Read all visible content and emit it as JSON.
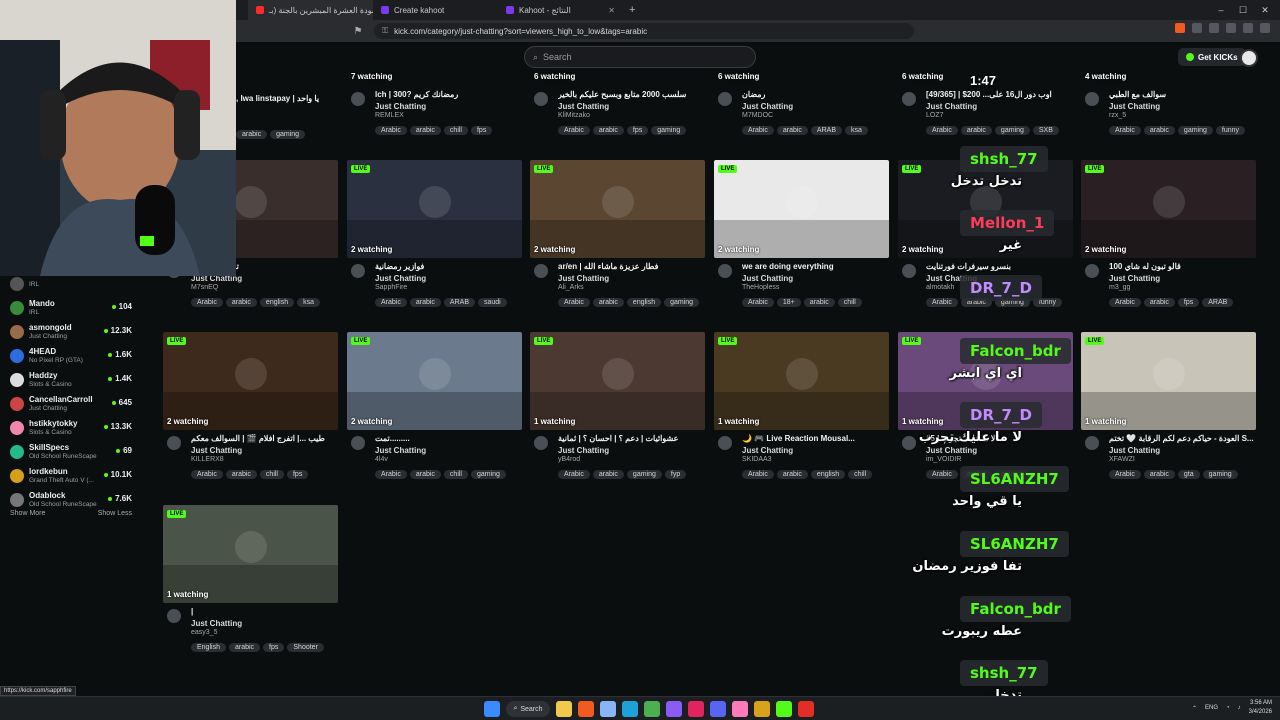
{
  "browser": {
    "tabs": [
      {
        "title": "أنشودة العشرة المبشرين بالجنة (بـ...",
        "active": true
      },
      {
        "title": "Create kahoot",
        "active": false
      },
      {
        "title": "Kahoot - النتائج",
        "active": false
      }
    ],
    "url": "kick.com/category/just-chatting?sort=viewers_high_to_low&tags=arabic"
  },
  "header": {
    "search_placeholder": "Search",
    "get_kicks": "Get KICKs"
  },
  "sidebar": {
    "items": [
      {
        "name": "",
        "category": "IRL",
        "viewers": ""
      },
      {
        "name": "Mando",
        "category": "IRL",
        "viewers": "104"
      },
      {
        "name": "asmongold",
        "category": "Just Chatting",
        "viewers": "12.3K"
      },
      {
        "name": "4HEAD",
        "category": "No Pixel RP (GTA)",
        "viewers": "1.6K"
      },
      {
        "name": "Haddzy",
        "category": "Slots & Casino",
        "viewers": "1.4K"
      },
      {
        "name": "CancellanCarroll",
        "category": "Just Chatting",
        "viewers": "645"
      },
      {
        "name": "hstikkytokky",
        "category": "Slots & Casino",
        "viewers": "13.3K"
      },
      {
        "name": "SkillSpecs",
        "category": "Old School RuneScape",
        "viewers": "69"
      },
      {
        "name": "lordkebun",
        "category": "Grand Theft Auto V (...",
        "viewers": "10.1K"
      },
      {
        "name": "Odablock",
        "category": "Old School RuneScape",
        "viewers": "7.6K"
      }
    ],
    "show_more": "Show More",
    "show_less": "Show Less"
  },
  "row0": [
    {
      "watching": "7 watching",
      "title": "lch | 300? رمضانك كريم",
      "category": "Just Chatting",
      "user": "REMLEX",
      "tags": [
        "Arabic",
        "arabic",
        "chill",
        "fps"
      ]
    },
    {
      "watching": "6 watching",
      "title": "سلسب 2000 متابع وبسبح عليكم بالخير",
      "category": "Just Chatting",
      "user": "KliMitzako",
      "tags": [
        "Arabic",
        "arabic",
        "fps",
        "gaming"
      ]
    },
    {
      "watching": "6 watching",
      "title": "رمضان",
      "category": "Just Chatting",
      "user": "M7MDOC",
      "tags": [
        "Arabic",
        "arabic",
        "ARAB",
        "ksa"
      ]
    },
    {
      "watching": "6 watching",
      "title": "[49/365] | $200 ...اوب دور ال16 على",
      "category": "Just Chatting",
      "user": "LOZ7",
      "tags": [
        "Arabic",
        "arabic",
        "gaming",
        "SXB"
      ]
    },
    {
      "watching": "4 watching",
      "title": "سوالف مع الطبي",
      "category": "Just Chatting",
      "user": "rzx_5",
      "tags": [
        "Arabic",
        "arabic",
        "gaming",
        "funny"
      ]
    }
  ],
  "row0_first": {
    "title": ", Iwa linstapay | يا واحد",
    "tags": [
      "arabic",
      "gaming"
    ]
  },
  "cards": [
    {
      "live": "LIVE",
      "watching": "",
      "title": "تختم رزديت ايا",
      "category": "Just Chatting",
      "user": "M7snEQ",
      "tags": [
        "Arabic",
        "arabic",
        "english",
        "ksa"
      ],
      "thumb": "#3a2e2c"
    },
    {
      "live": "LIVE",
      "watching": "2 watching",
      "title": "فوازير رمضانية",
      "category": "Just Chatting",
      "user": "SapphFire",
      "tags": [
        "Arabic",
        "arabic",
        "ARAB",
        "saudi"
      ],
      "thumb": "#2b3040"
    },
    {
      "live": "LIVE",
      "watching": "2 watching",
      "title": "ar/en | فطار عزيزة ماشاء الله",
      "category": "Just Chatting",
      "user": "Ali_Arks",
      "tags": [
        "Arabic",
        "arabic",
        "english",
        "gaming"
      ],
      "thumb": "#5a4631"
    },
    {
      "live": "LIVE",
      "watching": "2 watching",
      "title": "we are doing everything",
      "category": "Just Chatting",
      "user": "TheHopless",
      "tags": [
        "Arabic",
        "18+",
        "arabic",
        "chill"
      ],
      "thumb": "#e9e9e9"
    },
    {
      "live": "LIVE",
      "watching": "2 watching",
      "title": "بنسرو سيرفرات فورتنايت",
      "category": "Just Chatting",
      "user": "almotakh",
      "tags": [
        "Arabic",
        "arabic",
        "gaming",
        "funny"
      ],
      "thumb": "#1a1c22"
    },
    {
      "live": "LIVE",
      "watching": "2 watching",
      "title": "100 قالو تبون له شاي",
      "category": "Just Chatting",
      "user": "m3_gg",
      "tags": [
        "Arabic",
        "arabic",
        "fps",
        "ARAB"
      ],
      "thumb": "#2a2023"
    },
    {
      "live": "LIVE",
      "watching": "2 watching",
      "title": "طيب ...| اتفرج افلام 🎬 | السوالف معكم",
      "category": "Just Chatting",
      "user": "KILLERX8",
      "tags": [
        "Arabic",
        "arabic",
        "chill",
        "fps"
      ],
      "thumb": "#3e2a1c"
    },
    {
      "live": "LIVE",
      "watching": "2 watching",
      "title": "تمت.........",
      "category": "Just Chatting",
      "user": "4l4v",
      "tags": [
        "Arabic",
        "arabic",
        "chill",
        "gaming"
      ],
      "thumb": "#6b7a8c"
    },
    {
      "live": "LIVE",
      "watching": "1 watching",
      "title": "عشوائيات | دعم ؟ | احسان ؟ | ثمانية",
      "category": "Just Chatting",
      "user": "yB4rod",
      "tags": [
        "Arabic",
        "arabic",
        "gaming",
        "fyp"
      ],
      "thumb": "#4c3a32"
    },
    {
      "live": "LIVE",
      "watching": "1 watching",
      "title": "🌙 🎮 Live Reaction Mousal...",
      "category": "Just Chatting",
      "user": "SKIDAA3",
      "tags": [
        "Arabic",
        "arabic",
        "english",
        "chill"
      ],
      "thumb": "#4a3a22"
    },
    {
      "live": "LIVE",
      "watching": "1 watching",
      "title": "#5 | لا ما عليك تجرب",
      "category": "Just Chatting",
      "user": "im_VOIDIR",
      "tags": [
        "Arabic",
        "arabic",
        "gaming"
      ],
      "thumb": "#6a4a7a"
    },
    {
      "live": "LIVE",
      "watching": "1 watching",
      "title": "العودة - حياكم دعم لكم الرقابة 🤍 تختم S...",
      "category": "Just Chatting",
      "user": "XFAWZI",
      "tags": [
        "Arabic",
        "arabic",
        "gta",
        "gaming"
      ],
      "thumb": "#c9c4b8"
    },
    {
      "live": "LIVE",
      "watching": "1 watching",
      "title": "|",
      "category": "Just Chatting",
      "user": "easy3_5",
      "tags": [
        "English",
        "arabic",
        "fps",
        "Shooter"
      ],
      "thumb": "#4a5448"
    }
  ],
  "chat": {
    "timer": "1:47",
    "messages": [
      {
        "name": "shsh_77",
        "color": "#53fc18",
        "text": "تدخل تدخل"
      },
      {
        "name": "Mellon_1",
        "color": "#ff3b5c",
        "text": "غير"
      },
      {
        "name": "DR_7_D",
        "color": "#c18bff",
        "text": ""
      },
      {
        "name": "Falcon_bdr",
        "color": "#53fc18",
        "text": "اي اي ابشر"
      },
      {
        "name": "DR_7_D",
        "color": "#c18bff",
        "text": "لا ما عليك تجرب"
      },
      {
        "name": "SL6ANZH7",
        "color": "#53fc18",
        "text": "يا قي واحد"
      },
      {
        "name": "SL6ANZH7",
        "color": "#53fc18",
        "text": "تفا فوزير رمضان"
      },
      {
        "name": "Falcon_bdr",
        "color": "#53fc18",
        "text": "عطه ريبورت"
      },
      {
        "name": "shsh_77",
        "color": "#53fc18",
        "text": "تدخل"
      }
    ]
  },
  "status_link": "https://kick.com/sapphfire",
  "taskbar": {
    "search": "Search",
    "lang": "ENG",
    "time": "3:56 AM",
    "date": "3/4/2026"
  }
}
